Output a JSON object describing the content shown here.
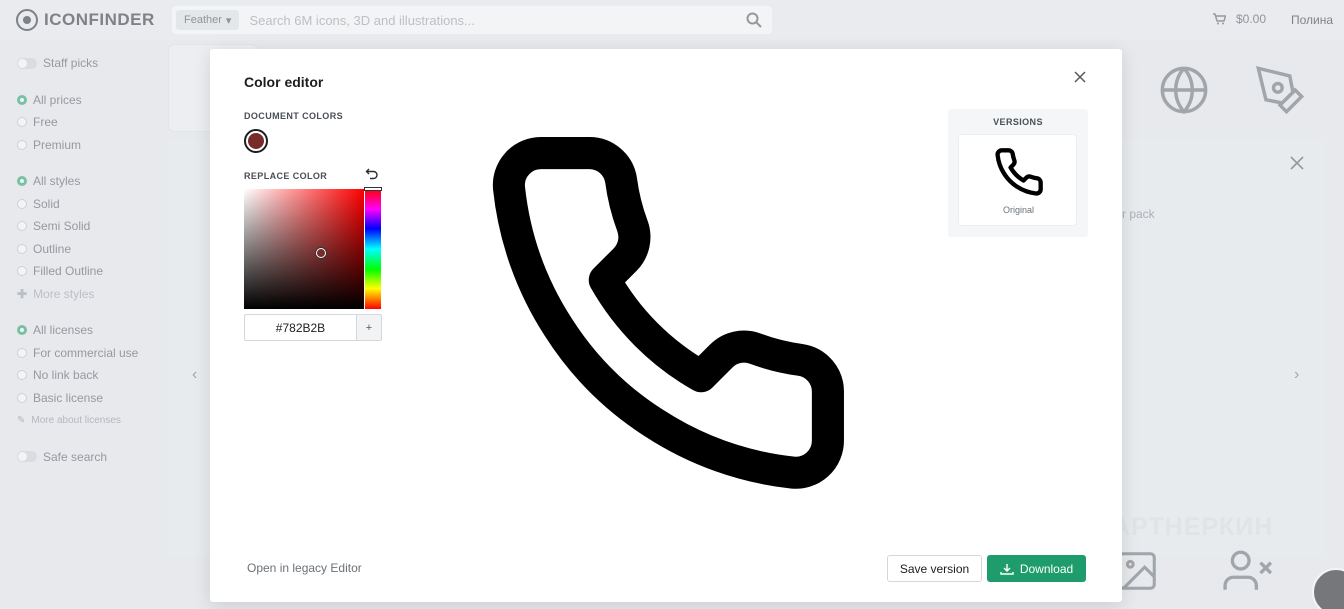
{
  "header": {
    "brand": "ICONFINDER",
    "search": {
      "style_filter": "Feather",
      "placeholder": "Search 6M icons, 3D and illustrations..."
    },
    "cart_amount": "$0.00",
    "user_name": "Полина"
  },
  "sidebar": {
    "staff_picks": "Staff picks",
    "prices": [
      "All prices",
      "Free",
      "Premium"
    ],
    "styles": [
      "All styles",
      "Solid",
      "Semi Solid",
      "Outline",
      "Filled Outline"
    ],
    "more_styles": "More styles",
    "licenses": [
      "All licenses",
      "For commercial use",
      "No link back",
      "Basic license"
    ],
    "more_licenses": "More about licenses",
    "safe_search": "Safe search"
  },
  "background": {
    "pack_text": "r pack"
  },
  "watermark": "ПАРТНЕРКИН",
  "modal": {
    "title": "Color editor",
    "document_colors_label": "DOCUMENT COLORS",
    "replace_color_label": "REPLACE COLOR",
    "document_colors": [
      "#782B2B"
    ],
    "picker": {
      "hex_value": "#782B2B",
      "hue_deg": 0,
      "saturation": 0.64,
      "brightness": 0.47,
      "add_label": "+"
    },
    "preview_icon": "phone-icon",
    "versions_label": "VERSIONS",
    "versions": [
      {
        "name": "Original",
        "icon": "phone-icon"
      }
    ],
    "legacy_link": "Open in legacy Editor",
    "save_label": "Save version",
    "download_label": "Download"
  },
  "colors": {
    "accent": "#1E9C6C",
    "selected_color": "#782B2B",
    "icon_color": "#000000"
  }
}
